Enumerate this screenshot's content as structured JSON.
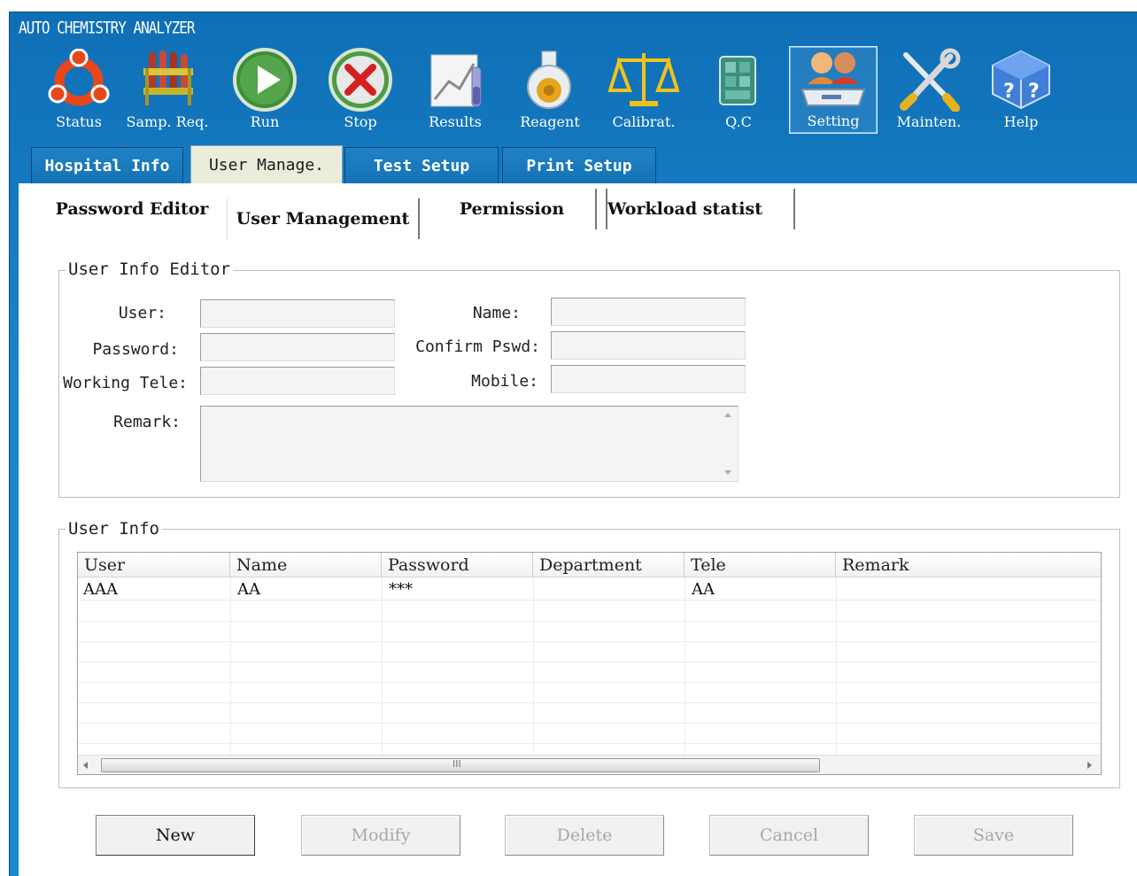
{
  "app": {
    "title": "AUTO CHEMISTRY ANALYZER"
  },
  "toolbar": [
    {
      "id": "status",
      "label": "Status",
      "icon": "ubuntu-icon"
    },
    {
      "id": "samp_req",
      "label": "Samp. Req.",
      "icon": "test-tubes-icon"
    },
    {
      "id": "run",
      "label": "Run",
      "icon": "play-icon"
    },
    {
      "id": "stop",
      "label": "Stop",
      "icon": "stop-icon"
    },
    {
      "id": "results",
      "label": "Results",
      "icon": "chart-icon"
    },
    {
      "id": "reagent",
      "label": "Reagent",
      "icon": "flask-icon"
    },
    {
      "id": "calibrat",
      "label": "Calibrat.",
      "icon": "balance-icon"
    },
    {
      "id": "qc",
      "label": "Q.C",
      "icon": "qc-cubes-icon"
    },
    {
      "id": "setting",
      "label": "Setting",
      "icon": "users-icon",
      "active": true
    },
    {
      "id": "mainten",
      "label": "Mainten.",
      "icon": "tools-icon"
    },
    {
      "id": "help",
      "label": "Help",
      "icon": "help-icon"
    }
  ],
  "tabs1": [
    "Hospital Info",
    "User Manage.",
    "Test Setup",
    "Print Setup"
  ],
  "tabs2": [
    "Password Editor",
    "User Management",
    "Permission",
    "Workload statist"
  ],
  "editor": {
    "legend": "User Info Editor",
    "user_label": "User:",
    "name_label": "Name:",
    "password_label": "Password:",
    "confirm_label": "Confirm Pswd:",
    "working_tele_label": "Working Tele:",
    "mobile_label": "Mobile:",
    "remark_label": "Remark:",
    "user_value": "",
    "name_value": "",
    "password_value": "",
    "confirm_value": "",
    "working_tele_value": "",
    "mobile_value": "",
    "remark_value": ""
  },
  "user_info": {
    "legend": "User Info",
    "columns": [
      "User",
      "Name",
      "Password",
      "Department",
      "Tele",
      "Remark"
    ],
    "rows": [
      [
        "AAA",
        "AA",
        "***",
        "",
        "AA",
        ""
      ]
    ],
    "scroll_grip": "III"
  },
  "actions": {
    "new": "New",
    "modify": "Modify",
    "delete": "Delete",
    "cancel": "Cancel",
    "save": "Save"
  },
  "colors": {
    "frame_blue": "#1a86cc",
    "active_tab": "#ececdc",
    "disabled_text": "#a8a8a8"
  }
}
